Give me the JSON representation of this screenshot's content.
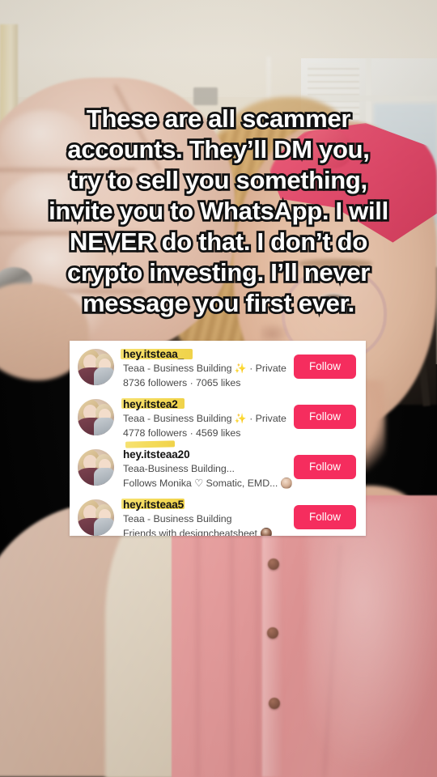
{
  "caption": {
    "text": "These are all scammer accounts. They’ll DM you, try to sell you something, invite you to WhatsApp. I will NEVER do that. I don’t do crypto investing. I’ll never message you first ever."
  },
  "colors": {
    "follow_button": "#f52d5e",
    "highlighter": "#f3d84e",
    "card_background": "#ffffff",
    "caption_fill": "#ffffff",
    "caption_stroke": "#111111"
  },
  "suggested_accounts_card": {
    "rows": [
      {
        "username": "hey.itsteaa_",
        "line1": "Teaa - Business Building",
        "line1_emoji": "✨",
        "line1_suffix": "· Private",
        "line2": "8736 followers · 7065 likes",
        "follow_label": "Follow",
        "avatar_name": "profile-photo-mother-and-child",
        "highlight_style": "under"
      },
      {
        "username": "hey.itstea2",
        "line1": "Teaa - Business Building",
        "line1_emoji": "✨",
        "line1_suffix": "· Private",
        "line2": "4778 followers · 4569 likes",
        "follow_label": "Follow",
        "avatar_name": "profile-photo-mother-and-child",
        "highlight_style": "short"
      },
      {
        "username": "hey.itsteaa20",
        "line1": "Teaa-Business Building...",
        "line1_emoji": "",
        "line1_suffix": "",
        "line2": "Follows Monika ♡ Somatic, EMD...",
        "line2_has_mini_avatar": true,
        "follow_label": "Follow",
        "avatar_name": "profile-photo-mother-and-child",
        "highlight_style": "above"
      },
      {
        "username": "hey.itsteaa5",
        "line1": "Teaa - Business Building",
        "line1_emoji": "",
        "line1_suffix": "",
        "line2": "Friends with designcheatsheet",
        "line2_has_mini_avatar": true,
        "follow_label": "Follow",
        "avatar_name": "profile-photo-mother-and-child",
        "highlight_style": "tight"
      }
    ]
  }
}
